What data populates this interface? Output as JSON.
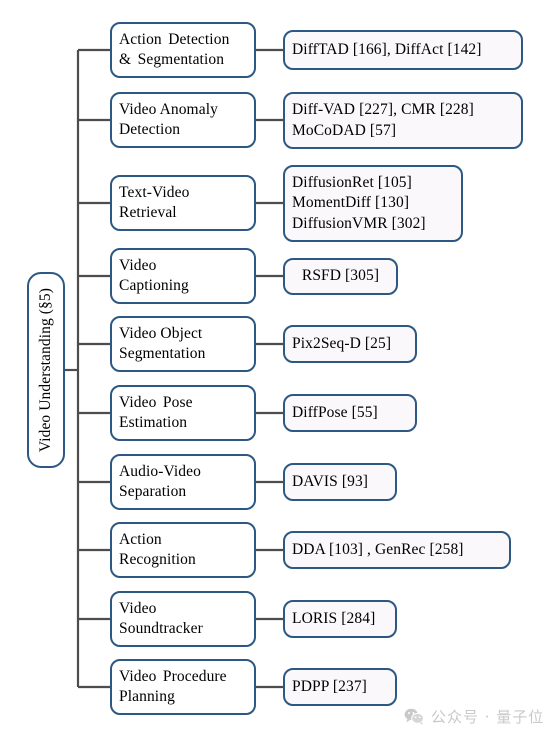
{
  "figure": {
    "type": "taxonomy-tree",
    "root": {
      "label": "Video Understanding (§5)",
      "orientation": "vertical-text"
    },
    "colors": {
      "node_border": "#2d5884",
      "node_fill": "#fbfafc",
      "connector": "#4d4d4d",
      "text": "#000000",
      "watermark": "#c9c9c9"
    },
    "branches": [
      {
        "category": {
          "lines": [
            "Action Detection",
            "& Segmentation"
          ]
        },
        "references": {
          "lines": [
            "DiffTAD [166], DiffAct [142]"
          ]
        }
      },
      {
        "category": {
          "lines": [
            "Video Anomaly",
            "Detection"
          ]
        },
        "references": {
          "lines": [
            "Diff-VAD [227], CMR [228]",
            "MoCoDAD [57]"
          ]
        }
      },
      {
        "category": {
          "lines": [
            "Text-Video",
            "Retrieval"
          ]
        },
        "references": {
          "lines": [
            "DiffusionRet [105]",
            "MomentDiff [130]",
            "DiffusionVMR [302]"
          ]
        }
      },
      {
        "category": {
          "lines": [
            "Video",
            "Captioning"
          ]
        },
        "references": {
          "lines": [
            "RSFD [305]"
          ]
        }
      },
      {
        "category": {
          "lines": [
            "Video Object",
            "Segmentation"
          ]
        },
        "references": {
          "lines": [
            "Pix2Seq-D [25]"
          ]
        }
      },
      {
        "category": {
          "lines": [
            "Video Pose",
            "Estimation"
          ]
        },
        "references": {
          "lines": [
            "DiffPose [55]"
          ]
        }
      },
      {
        "category": {
          "lines": [
            "Audio-Video",
            "Separation"
          ]
        },
        "references": {
          "lines": [
            "DAVIS [93]"
          ]
        }
      },
      {
        "category": {
          "lines": [
            "Action",
            "Recognition"
          ]
        },
        "references": {
          "lines": [
            "DDA [103] , GenRec [258]"
          ]
        }
      },
      {
        "category": {
          "lines": [
            "Video",
            "Soundtracker"
          ]
        },
        "references": {
          "lines": [
            "LORIS [284]"
          ]
        }
      },
      {
        "category": {
          "lines": [
            "Video Procedure",
            "Planning"
          ]
        },
        "references": {
          "lines": [
            "PDPP [237]"
          ]
        }
      }
    ]
  },
  "watermark": {
    "icon": "wechat-icon",
    "text": "公众号 · 量子位"
  }
}
